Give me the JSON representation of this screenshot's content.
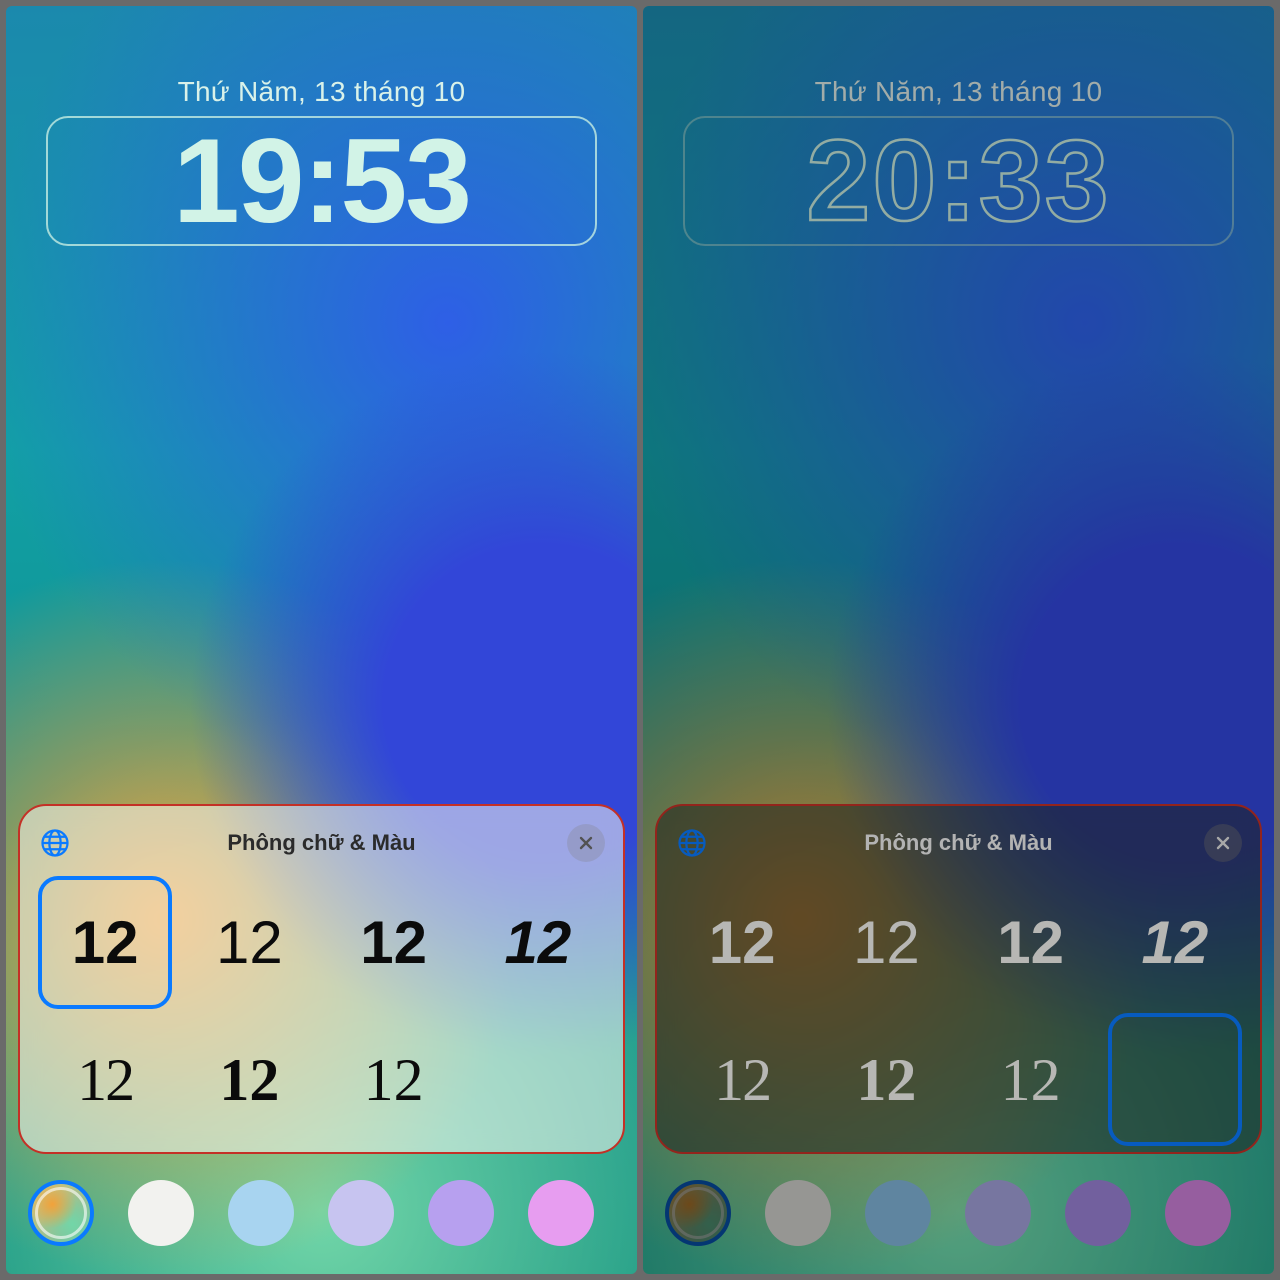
{
  "left": {
    "date": "Thứ Năm, 13 tháng 10",
    "time": "19:53",
    "sheet_title": "Phông chữ & Màu",
    "font_sample": "12",
    "selected_font_index": 0,
    "colors": [
      "gradient",
      "#f2f2ef",
      "#a8d4f0",
      "#c7c4f0",
      "#b7a0ef",
      "#e79df0"
    ],
    "selected_color_index": 0
  },
  "right": {
    "date": "Thứ Năm, 13 tháng 10",
    "time": "20:33",
    "sheet_title": "Phông chữ & Màu",
    "font_sample": "12",
    "selected_font_index": 7,
    "colors": [
      "gradient-dark",
      "#c9c9c4",
      "#7fb2d6",
      "#9f9ed6",
      "#9881d3",
      "#c87ed4"
    ],
    "selected_color_index": 0
  }
}
